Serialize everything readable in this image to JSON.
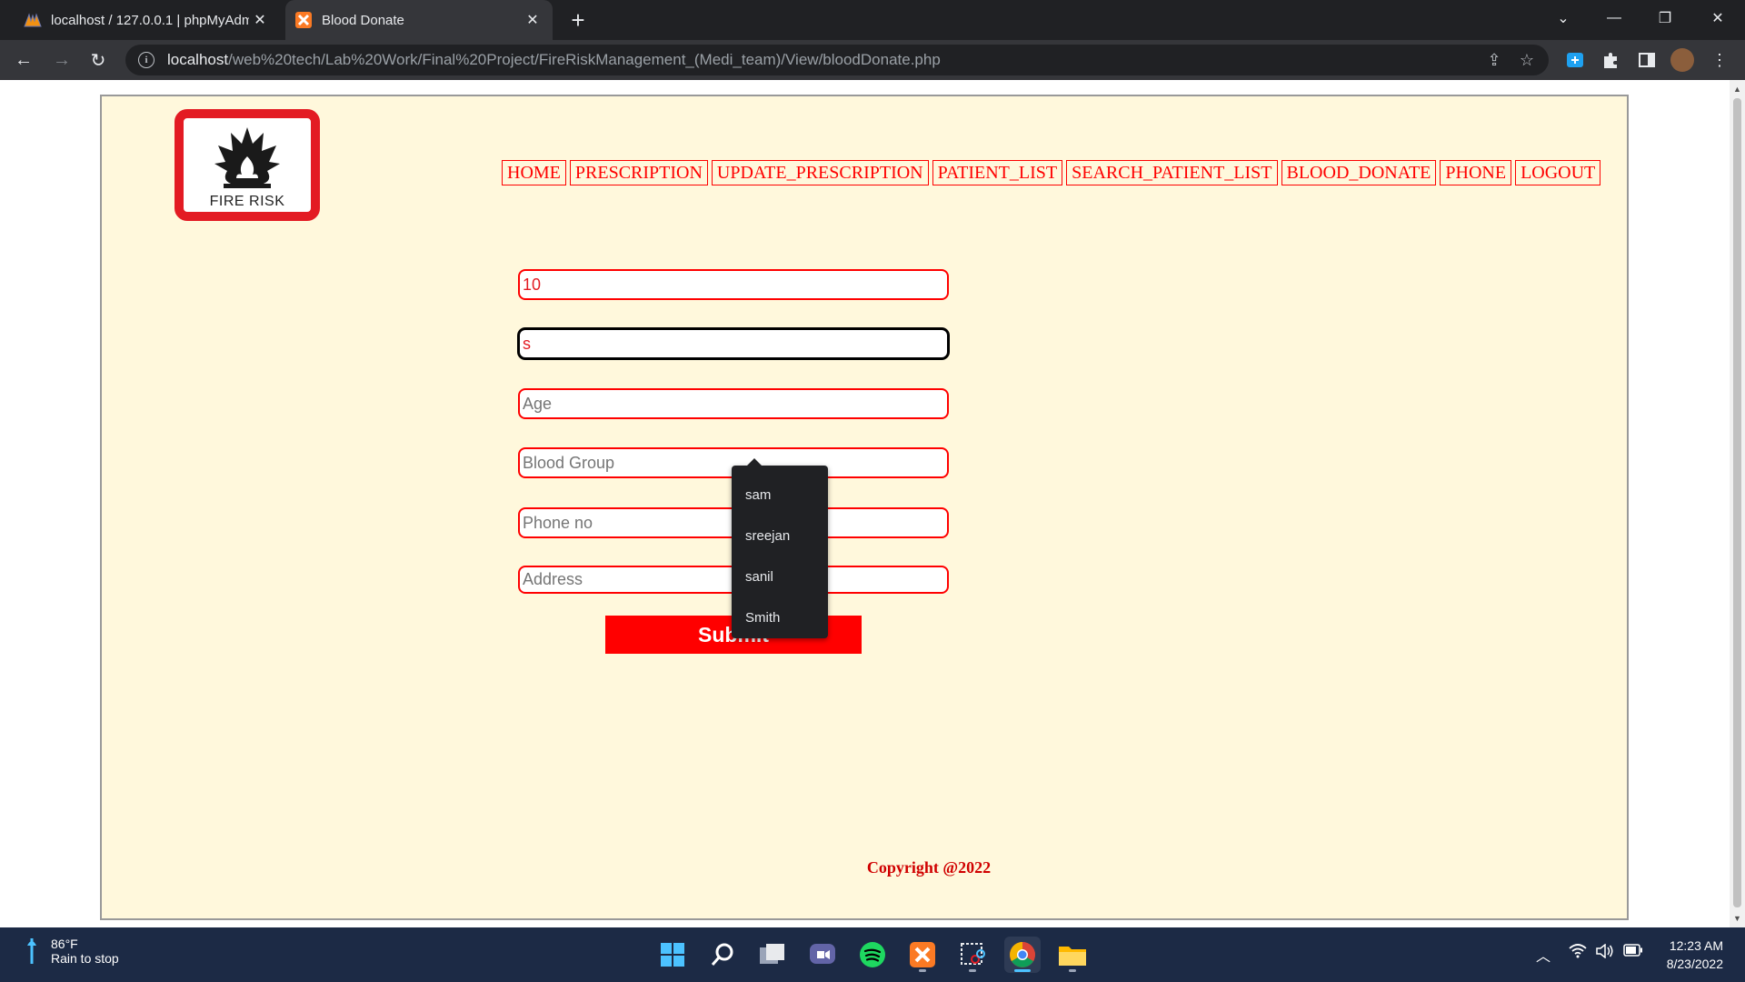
{
  "browser": {
    "tabs": [
      {
        "title": "localhost / 127.0.0.1 | phpMyAdmin",
        "active": false,
        "icon": "phpmyadmin-icon"
      },
      {
        "title": "Blood Donate",
        "active": true,
        "icon": "xampp-icon"
      }
    ],
    "url_host": "localhost",
    "url_path": "/web%20tech/Lab%20Work/Final%20Project/FireRiskManagement_(Medi_team)/View/bloodDonate.php"
  },
  "page": {
    "logo_caption": "FIRE RISK",
    "nav": [
      "HOME",
      "PRESCRIPTION",
      "UPDATE_PRESCRIPTION",
      "PATIENT_LIST",
      "SEARCH_PATIENT_LIST",
      "BLOOD_DONATE",
      "PHONE",
      "LOGOUT"
    ],
    "form": {
      "id_value": "10",
      "name_value": "s",
      "age_placeholder": "Age",
      "blood_group_placeholder": "Blood Group",
      "phone_placeholder": "Phone no",
      "address_placeholder": "Address",
      "submit_label": "Submit"
    },
    "autocomplete": [
      "sam",
      "sreejan",
      "sanil",
      "Smith"
    ],
    "copyright": "Copyright @2022"
  },
  "taskbar": {
    "weather_temp": "86°F",
    "weather_desc": "Rain to stop",
    "time": "12:23 AM",
    "date": "8/23/2022",
    "apps": [
      "start-icon",
      "search-icon",
      "task-view-icon",
      "teams-chat-icon",
      "spotify-icon",
      "xampp-icon",
      "snipping-tool-icon",
      "chrome-icon",
      "file-explorer-icon"
    ]
  },
  "colors": {
    "accent_red": "#ff0000",
    "page_bg": "#fff8dc",
    "chrome_dark": "#202124",
    "taskbar_bg": "#1c2a45"
  }
}
